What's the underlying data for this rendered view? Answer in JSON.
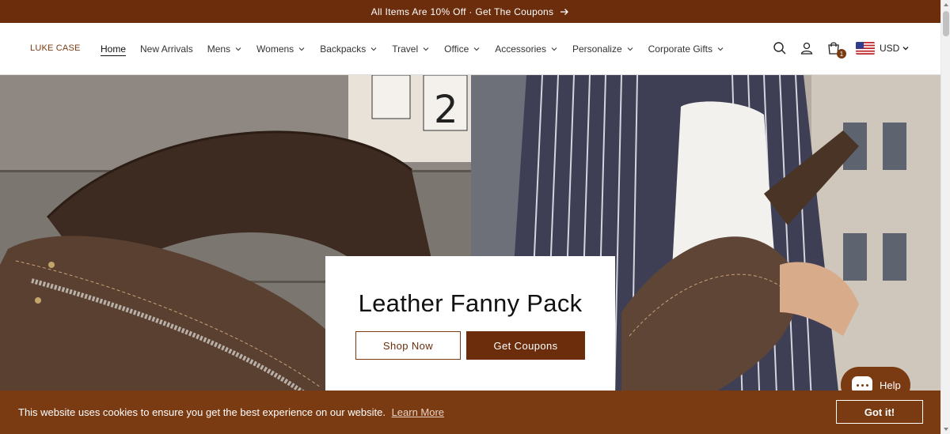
{
  "announcement": {
    "text": "All Items Are 10% Off · Get The Coupons",
    "icon": "arrow-right-icon"
  },
  "header": {
    "logo": "LUKE CASE",
    "nav": [
      {
        "label": "Home",
        "active": true,
        "dropdown": false
      },
      {
        "label": "New Arrivals",
        "dropdown": false
      },
      {
        "label": "Mens",
        "dropdown": true
      },
      {
        "label": "Womens",
        "dropdown": true
      },
      {
        "label": "Backpacks",
        "dropdown": true
      },
      {
        "label": "Travel",
        "dropdown": true
      },
      {
        "label": "Office",
        "dropdown": true
      },
      {
        "label": "Accessories",
        "dropdown": true
      },
      {
        "label": "Personalize",
        "dropdown": true
      },
      {
        "label": "Corporate Gifts",
        "dropdown": true
      }
    ],
    "icons": [
      "search-icon",
      "account-icon",
      "cart-icon"
    ],
    "cart_count": "1",
    "currency": "USD"
  },
  "hero": {
    "title": "Leather Fanny Pack",
    "primary_button": "Shop Now",
    "secondary_button": "Get Coupons"
  },
  "cookie_banner": {
    "text": "This website uses cookies to ensure you get the best experience on our website.",
    "link": "Learn More",
    "button": "Got it!"
  },
  "help_widget": {
    "label": "Help"
  },
  "colors": {
    "brand": "#6b2d0c",
    "cookie_bg": "#7a3a12",
    "white": "#ffffff"
  }
}
